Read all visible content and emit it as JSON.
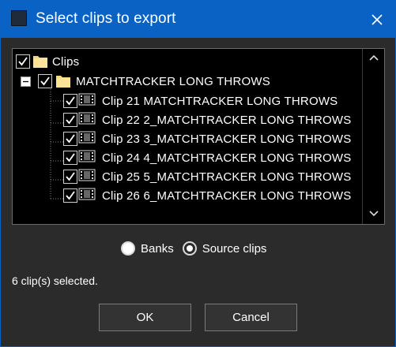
{
  "window": {
    "title": "Select clips to export"
  },
  "tree": {
    "root": {
      "label": "Clips",
      "checked": true
    },
    "bank": {
      "label": "MATCHTRACKER LONG THROWS",
      "checked": true,
      "expanded": true
    },
    "clips": [
      {
        "label": "Clip 21 MATCHTRACKER LONG THROWS",
        "checked": true
      },
      {
        "label": "Clip 22 2_MATCHTRACKER LONG THROWS",
        "checked": true
      },
      {
        "label": "Clip 23 3_MATCHTRACKER LONG THROWS",
        "checked": true
      },
      {
        "label": "Clip 24 4_MATCHTRACKER LONG THROWS",
        "checked": true
      },
      {
        "label": "Clip 25 5_MATCHTRACKER LONG THROWS",
        "checked": true
      },
      {
        "label": "Clip 26 6_MATCHTRACKER LONG THROWS",
        "checked": true
      }
    ]
  },
  "options": {
    "banks_label": "Banks",
    "source_clips_label": "Source clips",
    "selected": "Source clips"
  },
  "status_text": "6 clip(s) selected.",
  "buttons": {
    "ok": "OK",
    "cancel": "Cancel"
  },
  "colors": {
    "titlebar": "#0a63c4",
    "background": "#2b2b2b",
    "tree_background": "#000000",
    "folder": "#f5d77a"
  }
}
